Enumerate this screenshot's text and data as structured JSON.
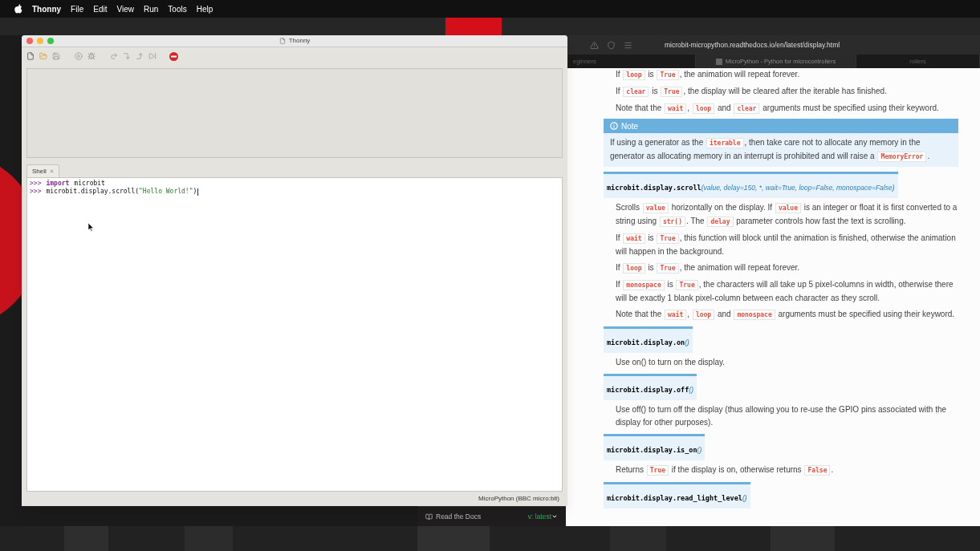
{
  "menu_bar": {
    "app": "Thonny",
    "items": [
      "File",
      "Edit",
      "View",
      "Run",
      "Tools",
      "Help"
    ]
  },
  "thonny": {
    "title": "Thonny",
    "shell_tab": {
      "label": "Shell",
      "selected": true
    },
    "shell_lines": [
      [
        {
          "kind": "prompt",
          "text": ">>>"
        },
        {
          "kind": "keyword",
          "text": "import"
        },
        {
          "kind": "plain",
          "text": "microbit"
        }
      ],
      [
        {
          "kind": "prompt",
          "text": ">>>"
        },
        {
          "kind": "plain",
          "text": "microbit.display.scroll("
        },
        {
          "kind": "string",
          "text": "\"Hello World!\""
        },
        {
          "kind": "plain",
          "text": ")"
        }
      ]
    ],
    "status": "MicroPython (BBC micro:bit)"
  },
  "browser": {
    "url": "microbit-micropython.readthedocs.io/en/latest/display.html",
    "tabs": [
      {
        "label": "eginners",
        "selected": false
      },
      {
        "label": "MicroPython - Python for microcontrollers",
        "selected": true
      },
      {
        "label": "rollers",
        "selected": false
      }
    ],
    "rtd_footer": {
      "label": "Read the Docs",
      "version": "v: latest"
    },
    "doc": [
      {
        "kind": "para",
        "segments": [
          {
            "kind": "text",
            "text": "If "
          },
          {
            "kind": "code",
            "text": "loop"
          },
          {
            "kind": "text",
            "text": " is "
          },
          {
            "kind": "code",
            "text": "True"
          },
          {
            "kind": "text",
            "text": ", the animation will repeat forever."
          }
        ]
      },
      {
        "kind": "para",
        "segments": [
          {
            "kind": "text",
            "text": "If "
          },
          {
            "kind": "code",
            "text": "clear"
          },
          {
            "kind": "text",
            "text": " is "
          },
          {
            "kind": "code",
            "text": "True"
          },
          {
            "kind": "text",
            "text": ", the display will be cleared after the iterable has finished."
          }
        ]
      },
      {
        "kind": "para",
        "segments": [
          {
            "kind": "text",
            "text": "Note that the "
          },
          {
            "kind": "code",
            "text": "wait"
          },
          {
            "kind": "text",
            "text": ", "
          },
          {
            "kind": "code",
            "text": "loop"
          },
          {
            "kind": "text",
            "text": " and "
          },
          {
            "kind": "code",
            "text": "clear"
          },
          {
            "kind": "text",
            "text": " arguments must be specified using their keyword."
          }
        ]
      },
      {
        "kind": "note",
        "title": "Note",
        "segments": [
          {
            "kind": "text",
            "text": "If using a generator as the "
          },
          {
            "kind": "code",
            "text": "iterable"
          },
          {
            "kind": "text",
            "text": ", then take care not to allocate any memory in the generator as allocating memory in an interrupt is prohibited and will raise a "
          },
          {
            "kind": "code",
            "text": "MemoryError"
          },
          {
            "kind": "text",
            "text": "."
          }
        ]
      },
      {
        "kind": "signature",
        "name": "microbit.display.scroll",
        "params": "(value, delay=150, *, wait=True, loop=False, monospace=False)"
      },
      {
        "kind": "para",
        "segments": [
          {
            "kind": "text",
            "text": "Scrolls "
          },
          {
            "kind": "code",
            "text": "value"
          },
          {
            "kind": "text",
            "text": " horizontally on the display. If "
          },
          {
            "kind": "code",
            "text": "value"
          },
          {
            "kind": "text",
            "text": " is an integer or float it is first converted to a string using "
          },
          {
            "kind": "code",
            "text": "str()"
          },
          {
            "kind": "text",
            "text": ". The "
          },
          {
            "kind": "code",
            "text": "delay"
          },
          {
            "kind": "text",
            "text": " parameter controls how fast the text is scrolling."
          }
        ]
      },
      {
        "kind": "para",
        "segments": [
          {
            "kind": "text",
            "text": "If "
          },
          {
            "kind": "code",
            "text": "wait"
          },
          {
            "kind": "text",
            "text": " is "
          },
          {
            "kind": "code",
            "text": "True"
          },
          {
            "kind": "text",
            "text": ", this function will block until the animation is finished, otherwise the animation will happen in the background."
          }
        ]
      },
      {
        "kind": "para",
        "segments": [
          {
            "kind": "text",
            "text": "If "
          },
          {
            "kind": "code",
            "text": "loop"
          },
          {
            "kind": "text",
            "text": " is "
          },
          {
            "kind": "code",
            "text": "True"
          },
          {
            "kind": "text",
            "text": ", the animation will repeat forever."
          }
        ]
      },
      {
        "kind": "para",
        "segments": [
          {
            "kind": "text",
            "text": "If "
          },
          {
            "kind": "code",
            "text": "monospace"
          },
          {
            "kind": "text",
            "text": " is "
          },
          {
            "kind": "code",
            "text": "True"
          },
          {
            "kind": "text",
            "text": ", the characters will all take up 5 pixel-columns in width, otherwise there will be exactly 1 blank pixel-column between each character as they scroll."
          }
        ]
      },
      {
        "kind": "para",
        "segments": [
          {
            "kind": "text",
            "text": "Note that the "
          },
          {
            "kind": "code",
            "text": "wait"
          },
          {
            "kind": "text",
            "text": ", "
          },
          {
            "kind": "code",
            "text": "loop"
          },
          {
            "kind": "text",
            "text": " and "
          },
          {
            "kind": "code",
            "text": "monospace"
          },
          {
            "kind": "text",
            "text": " arguments must be specified using their keyword."
          }
        ]
      },
      {
        "kind": "signature",
        "name": "microbit.display.on",
        "params": "()"
      },
      {
        "kind": "para",
        "segments": [
          {
            "kind": "text",
            "text": "Use on() to turn on the display."
          }
        ]
      },
      {
        "kind": "signature",
        "name": "microbit.display.off",
        "params": "()"
      },
      {
        "kind": "para",
        "segments": [
          {
            "kind": "text",
            "text": "Use off() to turn off the display (thus allowing you to re-use the GPIO pins associated with the display for other purposes)."
          }
        ]
      },
      {
        "kind": "signature",
        "name": "microbit.display.is_on",
        "params": "()"
      },
      {
        "kind": "para",
        "segments": [
          {
            "kind": "text",
            "text": "Returns "
          },
          {
            "kind": "code",
            "text": "True"
          },
          {
            "kind": "text",
            "text": " if the display is on, otherwise returns "
          },
          {
            "kind": "code",
            "text": "False"
          },
          {
            "kind": "text",
            "text": "."
          }
        ]
      },
      {
        "kind": "signature",
        "name": "microbit.display.read_light_level",
        "params": "()"
      }
    ]
  }
}
